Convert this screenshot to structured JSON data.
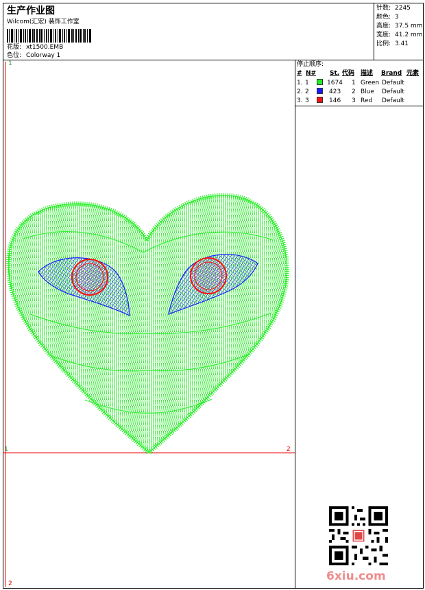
{
  "header": {
    "title": "生产作业图",
    "subtitle": "Wilcom(汇宏) 装饰工作室",
    "design": {
      "label": "花版:",
      "value": "xt1500.EMB"
    },
    "colorway": {
      "label": "色位:",
      "value": "Colorway 1"
    }
  },
  "stats": {
    "stitches": {
      "label": "针数:",
      "value": "2245"
    },
    "colors": {
      "label": "颜色:",
      "value": "3"
    },
    "height": {
      "label": "高度:",
      "value": "37.5 mm"
    },
    "width": {
      "label": "宽度:",
      "value": "41.2 mm"
    },
    "scale": {
      "label": "比例:",
      "value": "3.41"
    }
  },
  "stop_sequence": {
    "title": "停止顺序:",
    "columns": [
      "#",
      "N#",
      "St.",
      "代码",
      "描述",
      "Brand",
      "元素"
    ],
    "rows": [
      {
        "num": "1.",
        "n": "1",
        "st": "1674",
        "code": "1",
        "desc": "Green",
        "brand": "Default",
        "color": "#22ee22"
      },
      {
        "num": "2.",
        "n": "2",
        "st": "423",
        "code": "2",
        "desc": "Blue",
        "brand": "Default",
        "color": "#1a1aff"
      },
      {
        "num": "3.",
        "n": "3",
        "st": "146",
        "code": "3",
        "desc": "Red",
        "brand": "Default",
        "color": "#ff1111"
      }
    ]
  },
  "axis": {
    "top_left": "1",
    "mid_left": "1",
    "mid_right": "2",
    "bottom_left": "2"
  },
  "watermark": "6xiu.com",
  "colors": {
    "frame": "#000000",
    "guide": "#ee0000",
    "green": "#22ee22",
    "blue": "#1a1aff",
    "red": "#ff1111"
  }
}
